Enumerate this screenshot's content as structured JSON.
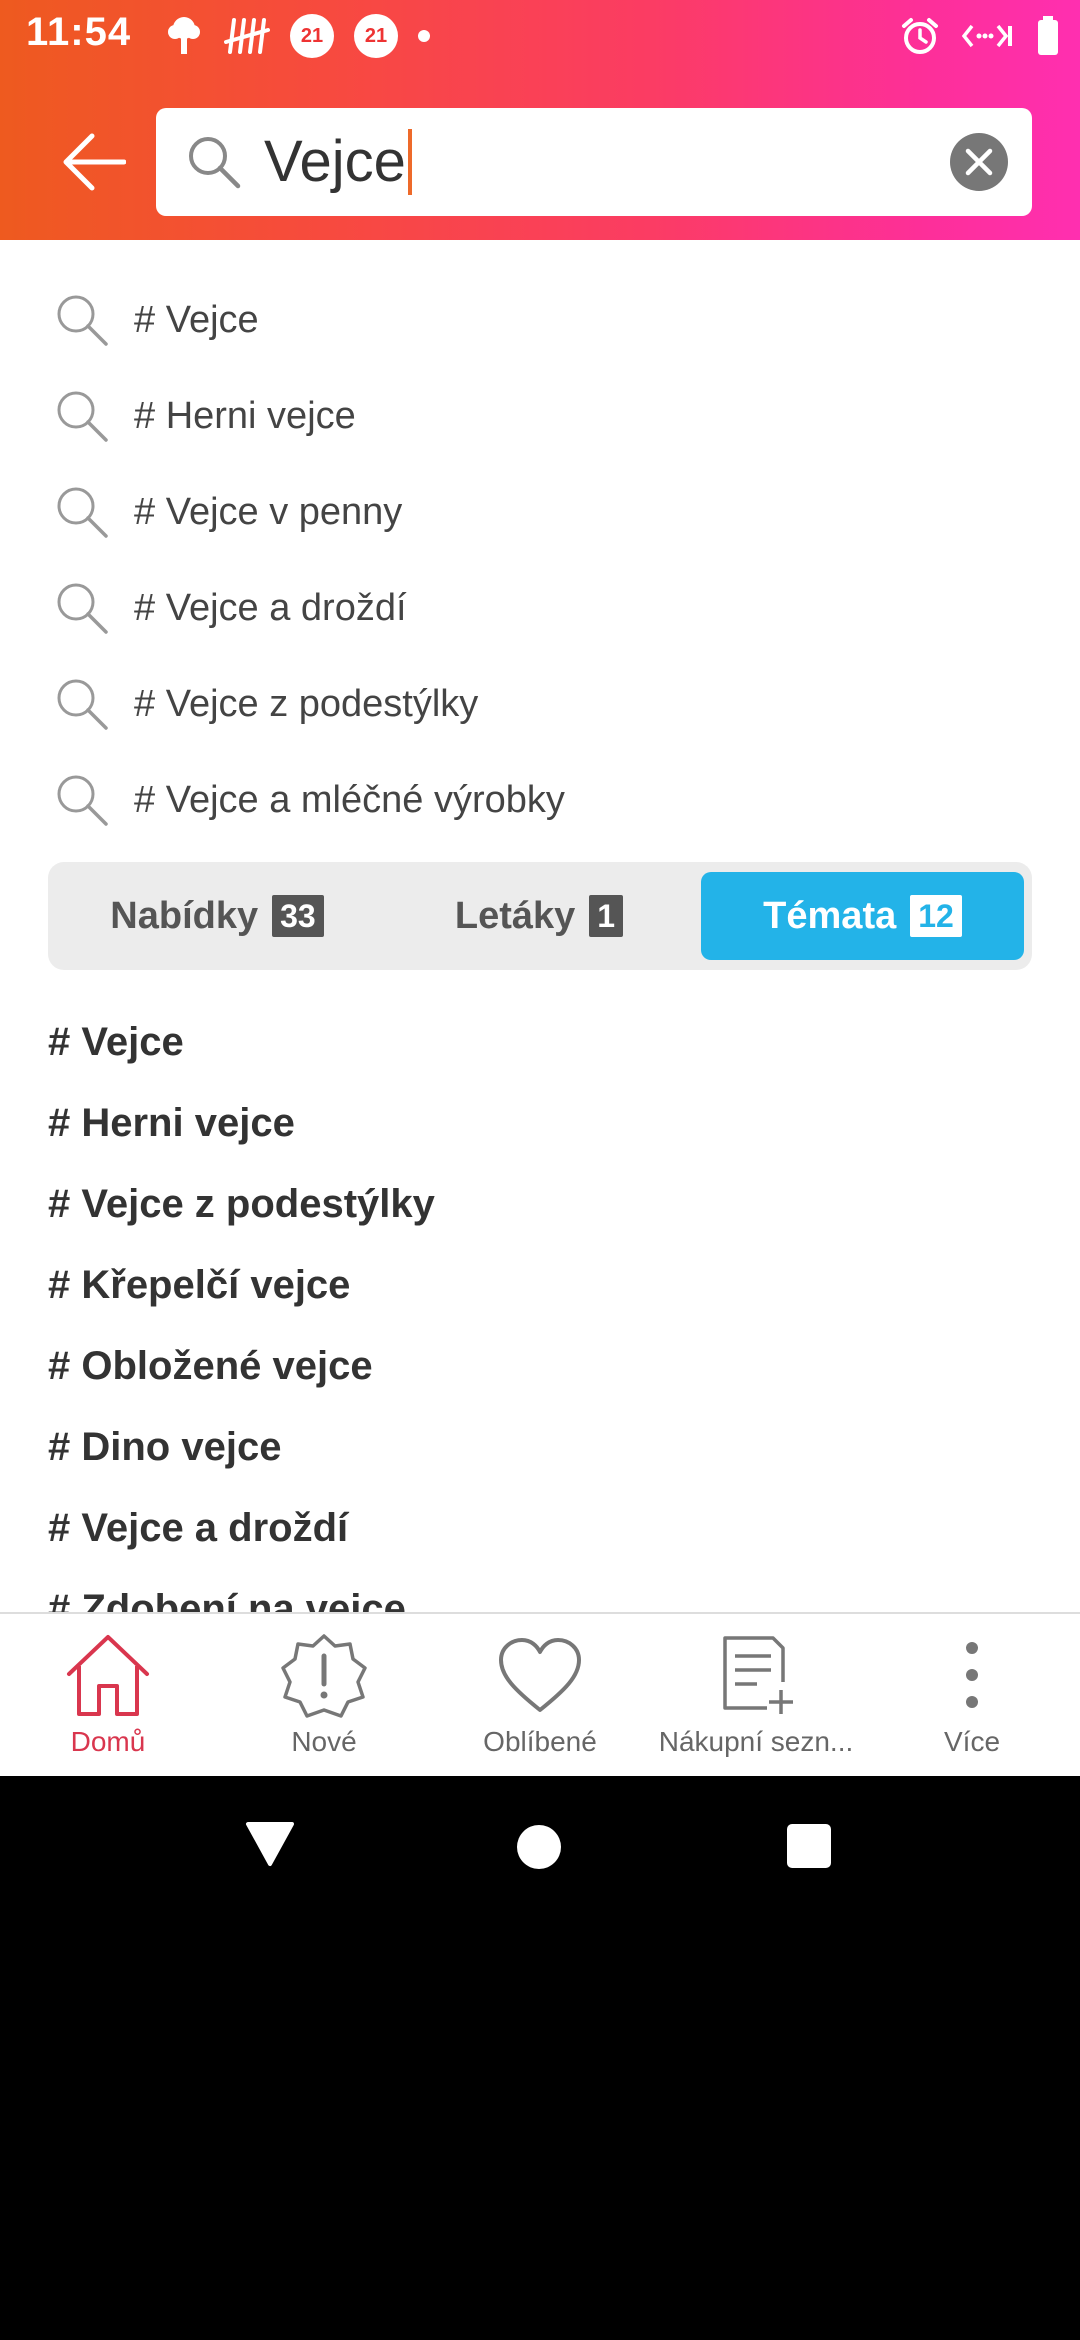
{
  "status": {
    "time": "11:54",
    "badge1": "21",
    "badge2": "21"
  },
  "search": {
    "query": "Vejce"
  },
  "suggestions": [
    "# Vejce",
    "# Herni vejce",
    "# Vejce v penny",
    "# Vejce a droždí",
    "# Vejce z podestýlky",
    "# Vejce a mléčné výrobky"
  ],
  "tabs": [
    {
      "label": "Nabídky",
      "count": "33"
    },
    {
      "label": "Letáky",
      "count": "1"
    },
    {
      "label": "Témata",
      "count": "12"
    }
  ],
  "topics": [
    "# Vejce",
    "# Herni vejce",
    "# Vejce z podestýlky",
    "# Křepelčí vejce",
    "# Obložené vejce",
    "# Dino vejce",
    "# Vejce a droždí",
    "# Zdobení na vejce"
  ],
  "nav": [
    {
      "label": "Domů"
    },
    {
      "label": "Nové"
    },
    {
      "label": "Oblíbené"
    },
    {
      "label": "Nákupní sezn..."
    },
    {
      "label": "Více"
    }
  ],
  "colors": {
    "accent": "#d9364e",
    "tab_active": "#23b3e8",
    "caret": "#ee6a2a"
  }
}
